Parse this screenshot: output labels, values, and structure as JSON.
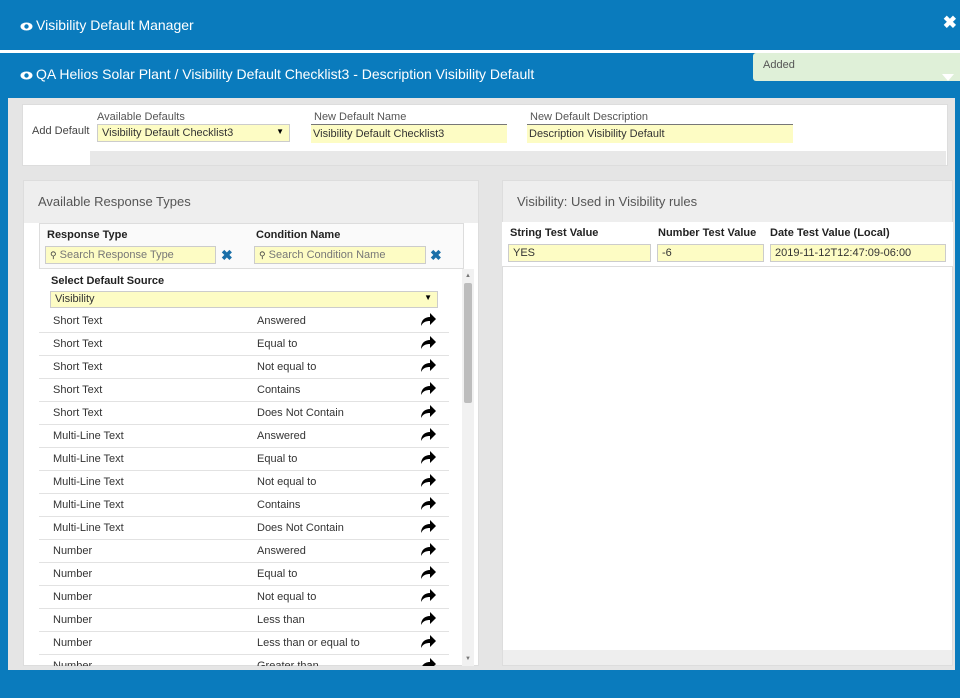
{
  "header": {
    "title": "Visibility Default Manager",
    "close_icon": "times-icon"
  },
  "subheader": {
    "title": "QA Helios Solar Plant / Visibility Default Checklist3 - Description Visibility Default"
  },
  "toast": {
    "text": "Added"
  },
  "add_default": {
    "label": "Add Default",
    "available_defaults_label": "Available Defaults",
    "available_defaults_value": "Visibility Default Checklist3",
    "new_name_label": "New Default Name",
    "new_name_value": "Visibility Default Checklist3",
    "new_desc_label": "New Default Description",
    "new_desc_value": "Description Visibility Default"
  },
  "left_panel": {
    "title": "Available Response Types",
    "col_response": "Response Type",
    "col_condition": "Condition Name",
    "search_response_placeholder": "Search Response Type",
    "search_condition_placeholder": "Search Condition Name",
    "source_label": "Select Default Source",
    "source_value": "Visibility",
    "rows": [
      {
        "type": "Short Text",
        "condition": "Answered"
      },
      {
        "type": "Short Text",
        "condition": "Equal to"
      },
      {
        "type": "Short Text",
        "condition": "Not equal to"
      },
      {
        "type": "Short Text",
        "condition": "Contains"
      },
      {
        "type": "Short Text",
        "condition": "Does Not Contain"
      },
      {
        "type": "Multi-Line Text",
        "condition": "Answered"
      },
      {
        "type": "Multi-Line Text",
        "condition": "Equal to"
      },
      {
        "type": "Multi-Line Text",
        "condition": "Not equal to"
      },
      {
        "type": "Multi-Line Text",
        "condition": "Contains"
      },
      {
        "type": "Multi-Line Text",
        "condition": "Does Not Contain"
      },
      {
        "type": "Number",
        "condition": "Answered"
      },
      {
        "type": "Number",
        "condition": "Equal to"
      },
      {
        "type": "Number",
        "condition": "Not equal to"
      },
      {
        "type": "Number",
        "condition": "Less than"
      },
      {
        "type": "Number",
        "condition": "Less than or equal to"
      },
      {
        "type": "Number",
        "condition": "Greater than"
      }
    ]
  },
  "right_panel": {
    "title": "Visibility: Used in Visibility rules",
    "col_string": "String Test Value",
    "col_number": "Number Test Value",
    "col_date": "Date Test Value (Local)",
    "string_value": "YES",
    "number_value": "-6",
    "date_value": "2019-11-12T12:47:09-06:00"
  }
}
